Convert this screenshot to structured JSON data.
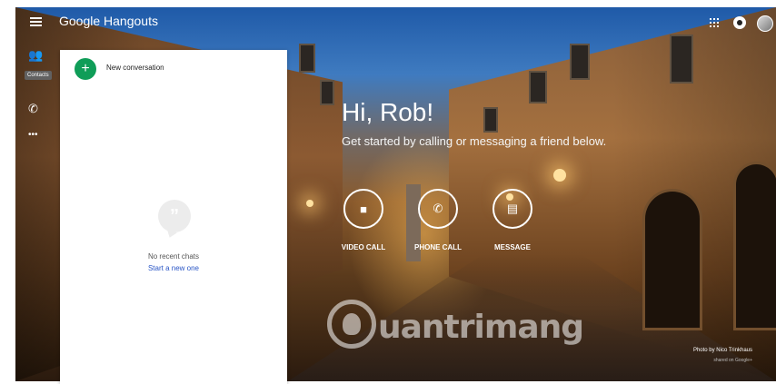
{
  "app": {
    "title": "Google Hangouts"
  },
  "header": {
    "menu_icon": "hamburger-menu-icon",
    "apps_icon": "apps-grid-icon",
    "notifications_icon": "notifications-icon",
    "avatar_icon": "user-avatar"
  },
  "sidebar": {
    "items": [
      {
        "icon": "contacts-icon",
        "tooltip": "Contacts"
      },
      {
        "icon": "phone-icon"
      },
      {
        "icon": "more-icon"
      }
    ]
  },
  "panel": {
    "new_conversation": "New conversation",
    "empty_title": "No recent chats",
    "empty_link": "Start a new one"
  },
  "main": {
    "greeting": "Hi, Rob!",
    "subtitle": "Get started by calling or messaging a friend below.",
    "actions": [
      {
        "label": "VIDEO CALL",
        "icon": "video-camera-icon"
      },
      {
        "label": "PHONE CALL",
        "icon": "phone-icon"
      },
      {
        "label": "MESSAGE",
        "icon": "message-icon"
      }
    ]
  },
  "photo": {
    "credit": "Photo by Nico Trinkhaus",
    "shared": "shared on Google+"
  },
  "watermark": {
    "text": "uantrimang"
  },
  "colors": {
    "accent_green": "#0f9d58",
    "link_blue": "#2a56c6"
  }
}
